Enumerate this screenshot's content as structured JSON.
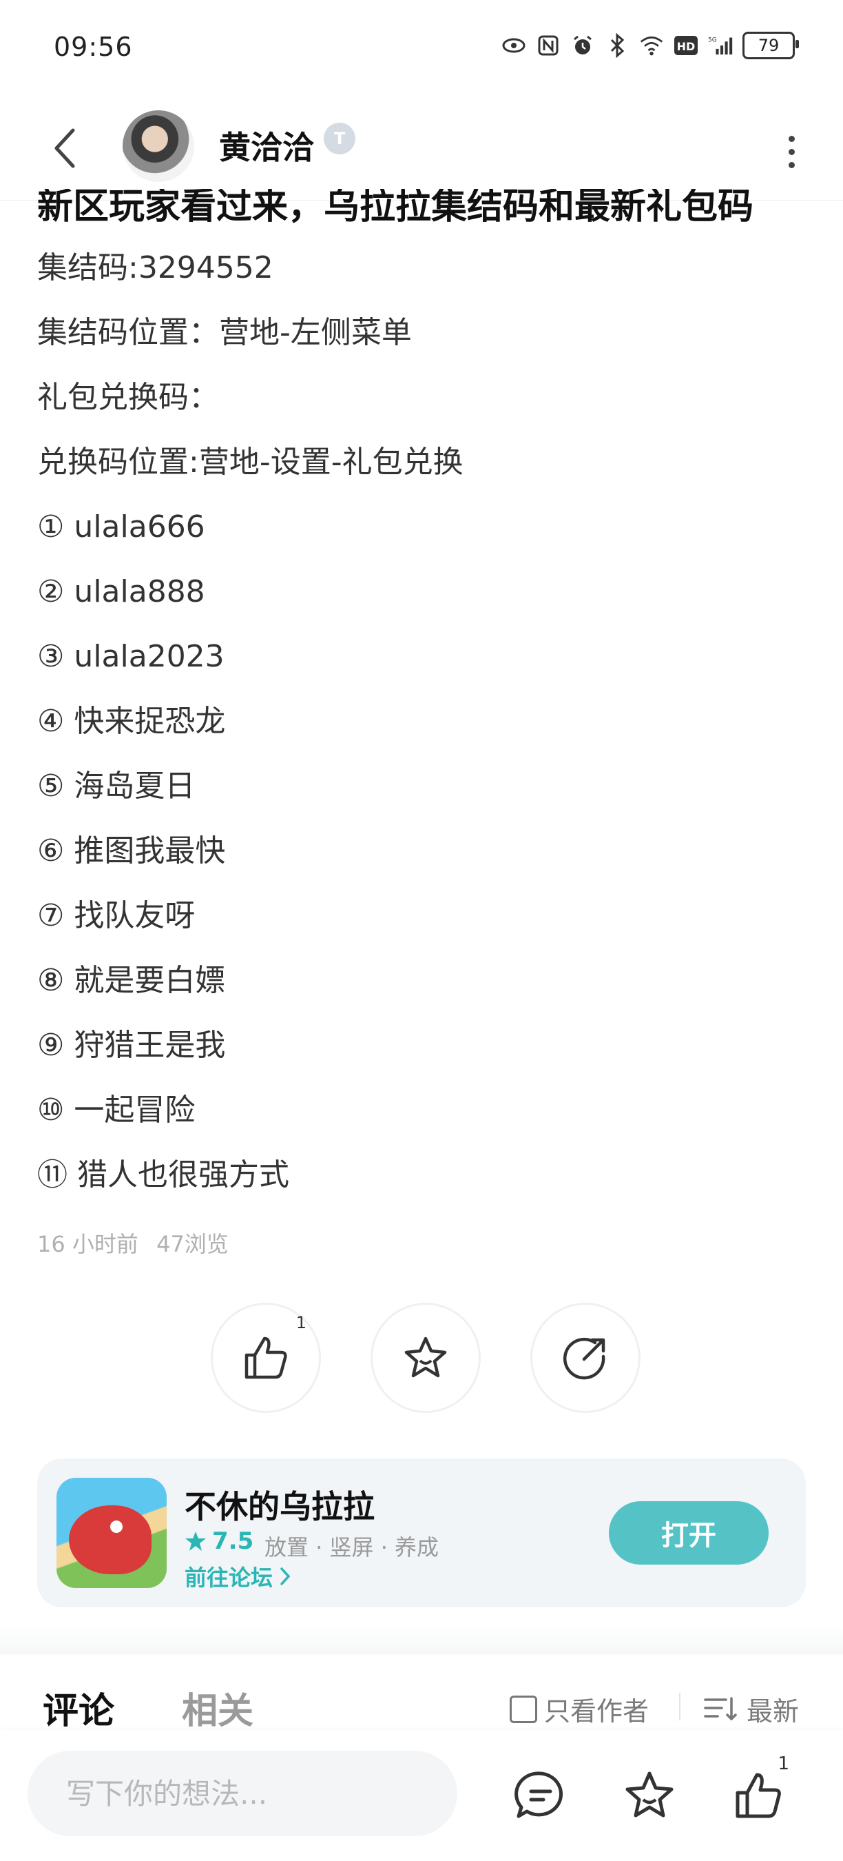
{
  "status_bar": {
    "time": "09:56",
    "battery": "79",
    "icons": [
      "eye-icon",
      "nfc-icon",
      "alarm-icon",
      "bluetooth-icon",
      "wifi-icon",
      "hd-icon",
      "signal-icon"
    ]
  },
  "header": {
    "user_name": "黄洽洽",
    "level_badge": "T",
    "icons": [
      "back-icon",
      "more-icon"
    ]
  },
  "post": {
    "title": "新区玩家看过来，乌拉拉集结码和最新礼包码",
    "lines": [
      "集结码:3294552",
      "集结码位置：营地-左侧菜单",
      "礼包兑换码：",
      "兑换码位置:营地-设置-礼包兑换",
      "① ulala666",
      "② ulala888",
      "③ ulala2023",
      "④ 快来捉恐龙",
      "⑤ 海岛夏日",
      "⑥ 推图我最快",
      "⑦ 找队友呀",
      "⑧ 就是要白嫖",
      "⑨ 狩猎王是我",
      "⑩ 一起冒险",
      "⑪ 猎人也很强方式"
    ],
    "time_ago": "16 小时前",
    "views": "47浏览"
  },
  "actions": {
    "like_count": "1",
    "icons": [
      "like-icon",
      "favorite-icon",
      "share-icon"
    ]
  },
  "game_card": {
    "name": "不休的乌拉拉",
    "rating": "7.5",
    "tags": "放置 · 竖屏 · 养成",
    "forum_link": "前往论坛",
    "open_button": "打开"
  },
  "tabs": {
    "comments": "评论",
    "related": "相关",
    "author_only": "只看作者",
    "sort": "最新"
  },
  "bottom_bar": {
    "input_placeholder": "写下你的想法...",
    "like_count": "1",
    "icons": [
      "comment-icon",
      "favorite-icon",
      "like-icon"
    ]
  },
  "colors": {
    "accent": "#55c2c6",
    "rating": "#2bb5b5"
  }
}
